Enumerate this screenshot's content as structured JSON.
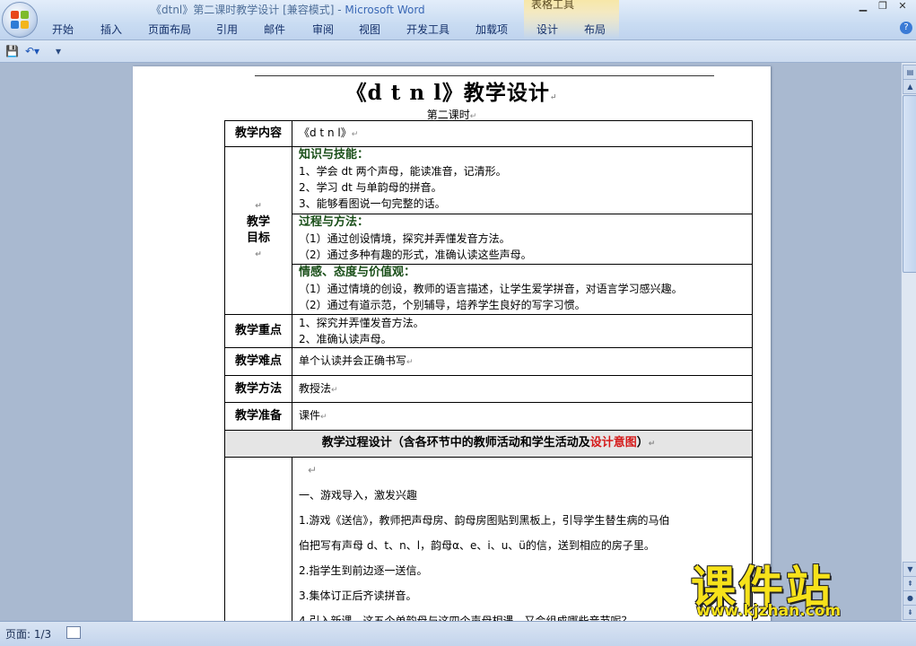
{
  "window": {
    "title_doc": "《dtnl》第二课时教学设计 [兼容模式] - ",
    "title_app": "Microsoft Word",
    "context_tab_group": "表格工具"
  },
  "ribbon": {
    "tabs": [
      "开始",
      "插入",
      "页面布局",
      "引用",
      "邮件",
      "审阅",
      "视图",
      "开发工具",
      "加载项",
      "设计",
      "布局"
    ]
  },
  "document": {
    "title": "《d t n l》教学设计",
    "subtitle": "第二课时",
    "labels": {
      "content": "教学内容",
      "goals_1": "教学",
      "goals_2": "目标",
      "key_points": "教学重点",
      "difficulties": "教学难点",
      "methods": "教学方法",
      "prep": "教学准备"
    },
    "content_value": "《d t n l》",
    "goals": {
      "knowledge_head": "知识与技能：",
      "knowledge": [
        "1、学会 dt 两个声母，能读准音，记清形。",
        "2、学习 dt 与单韵母的拼音。",
        "3、能够看图说一句完整的话。"
      ],
      "process_head": "过程与方法：",
      "process": [
        "（1）通过创设情境，探究并弄懂发音方法。",
        "（2）通过多种有趣的形式，准确认读这些声母。"
      ],
      "emotion_head": "情感、态度与价值观：",
      "emotion": [
        "（1）通过情境的创设，教师的语言描述，让学生爱学拼音，对语言学习感兴趣。",
        "（2）通过有道示范，个别辅导，培养学生良好的写字习惯。"
      ]
    },
    "key_points": [
      "1、探究并弄懂发音方法。",
      "2、准确认读声母。"
    ],
    "difficulties_value": "单个认读并会正确书写",
    "methods_value": "教授法",
    "prep_value": "课件",
    "process_header_main": "教学过程设计（含各环节中的教师活动和学生活动及",
    "process_header_red": "设计意图",
    "process_header_end": "）",
    "process_lines": [
      "一、游戏导入，激发兴趣",
      "1.游戏《送信》，教师把声母房、韵母房图贴到黑板上，引导学生替生病的马伯",
      "伯把写有声母 d、t、n、l，韵母α、e、i、u、ü的信，送到相应的房子里。",
      "2.指学生到前边逐一送信。",
      "3.集体订正后齐读拼音。",
      "4.引入新课，这五个单韵母与这四个声母相遇，又会组成哪些音节呢？"
    ]
  },
  "status": {
    "page": "页面: 1/3"
  },
  "watermark": {
    "cn": "课件站",
    "url": "www.kjzhan.com"
  }
}
